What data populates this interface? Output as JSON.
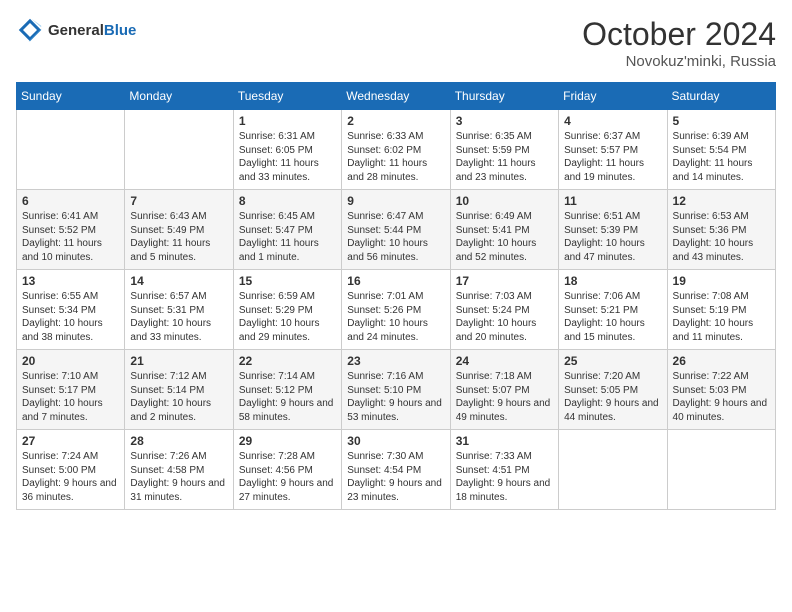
{
  "header": {
    "logo_line1": "General",
    "logo_line2": "Blue",
    "month": "October 2024",
    "location": "Novokuz'minki, Russia"
  },
  "days_of_week": [
    "Sunday",
    "Monday",
    "Tuesday",
    "Wednesday",
    "Thursday",
    "Friday",
    "Saturday"
  ],
  "weeks": [
    [
      {
        "day": "",
        "info": ""
      },
      {
        "day": "",
        "info": ""
      },
      {
        "day": "1",
        "info": "Sunrise: 6:31 AM\nSunset: 6:05 PM\nDaylight: 11 hours and 33 minutes."
      },
      {
        "day": "2",
        "info": "Sunrise: 6:33 AM\nSunset: 6:02 PM\nDaylight: 11 hours and 28 minutes."
      },
      {
        "day": "3",
        "info": "Sunrise: 6:35 AM\nSunset: 5:59 PM\nDaylight: 11 hours and 23 minutes."
      },
      {
        "day": "4",
        "info": "Sunrise: 6:37 AM\nSunset: 5:57 PM\nDaylight: 11 hours and 19 minutes."
      },
      {
        "day": "5",
        "info": "Sunrise: 6:39 AM\nSunset: 5:54 PM\nDaylight: 11 hours and 14 minutes."
      }
    ],
    [
      {
        "day": "6",
        "info": "Sunrise: 6:41 AM\nSunset: 5:52 PM\nDaylight: 11 hours and 10 minutes."
      },
      {
        "day": "7",
        "info": "Sunrise: 6:43 AM\nSunset: 5:49 PM\nDaylight: 11 hours and 5 minutes."
      },
      {
        "day": "8",
        "info": "Sunrise: 6:45 AM\nSunset: 5:47 PM\nDaylight: 11 hours and 1 minute."
      },
      {
        "day": "9",
        "info": "Sunrise: 6:47 AM\nSunset: 5:44 PM\nDaylight: 10 hours and 56 minutes."
      },
      {
        "day": "10",
        "info": "Sunrise: 6:49 AM\nSunset: 5:41 PM\nDaylight: 10 hours and 52 minutes."
      },
      {
        "day": "11",
        "info": "Sunrise: 6:51 AM\nSunset: 5:39 PM\nDaylight: 10 hours and 47 minutes."
      },
      {
        "day": "12",
        "info": "Sunrise: 6:53 AM\nSunset: 5:36 PM\nDaylight: 10 hours and 43 minutes."
      }
    ],
    [
      {
        "day": "13",
        "info": "Sunrise: 6:55 AM\nSunset: 5:34 PM\nDaylight: 10 hours and 38 minutes."
      },
      {
        "day": "14",
        "info": "Sunrise: 6:57 AM\nSunset: 5:31 PM\nDaylight: 10 hours and 33 minutes."
      },
      {
        "day": "15",
        "info": "Sunrise: 6:59 AM\nSunset: 5:29 PM\nDaylight: 10 hours and 29 minutes."
      },
      {
        "day": "16",
        "info": "Sunrise: 7:01 AM\nSunset: 5:26 PM\nDaylight: 10 hours and 24 minutes."
      },
      {
        "day": "17",
        "info": "Sunrise: 7:03 AM\nSunset: 5:24 PM\nDaylight: 10 hours and 20 minutes."
      },
      {
        "day": "18",
        "info": "Sunrise: 7:06 AM\nSunset: 5:21 PM\nDaylight: 10 hours and 15 minutes."
      },
      {
        "day": "19",
        "info": "Sunrise: 7:08 AM\nSunset: 5:19 PM\nDaylight: 10 hours and 11 minutes."
      }
    ],
    [
      {
        "day": "20",
        "info": "Sunrise: 7:10 AM\nSunset: 5:17 PM\nDaylight: 10 hours and 7 minutes."
      },
      {
        "day": "21",
        "info": "Sunrise: 7:12 AM\nSunset: 5:14 PM\nDaylight: 10 hours and 2 minutes."
      },
      {
        "day": "22",
        "info": "Sunrise: 7:14 AM\nSunset: 5:12 PM\nDaylight: 9 hours and 58 minutes."
      },
      {
        "day": "23",
        "info": "Sunrise: 7:16 AM\nSunset: 5:10 PM\nDaylight: 9 hours and 53 minutes."
      },
      {
        "day": "24",
        "info": "Sunrise: 7:18 AM\nSunset: 5:07 PM\nDaylight: 9 hours and 49 minutes."
      },
      {
        "day": "25",
        "info": "Sunrise: 7:20 AM\nSunset: 5:05 PM\nDaylight: 9 hours and 44 minutes."
      },
      {
        "day": "26",
        "info": "Sunrise: 7:22 AM\nSunset: 5:03 PM\nDaylight: 9 hours and 40 minutes."
      }
    ],
    [
      {
        "day": "27",
        "info": "Sunrise: 7:24 AM\nSunset: 5:00 PM\nDaylight: 9 hours and 36 minutes."
      },
      {
        "day": "28",
        "info": "Sunrise: 7:26 AM\nSunset: 4:58 PM\nDaylight: 9 hours and 31 minutes."
      },
      {
        "day": "29",
        "info": "Sunrise: 7:28 AM\nSunset: 4:56 PM\nDaylight: 9 hours and 27 minutes."
      },
      {
        "day": "30",
        "info": "Sunrise: 7:30 AM\nSunset: 4:54 PM\nDaylight: 9 hours and 23 minutes."
      },
      {
        "day": "31",
        "info": "Sunrise: 7:33 AM\nSunset: 4:51 PM\nDaylight: 9 hours and 18 minutes."
      },
      {
        "day": "",
        "info": ""
      },
      {
        "day": "",
        "info": ""
      }
    ]
  ]
}
